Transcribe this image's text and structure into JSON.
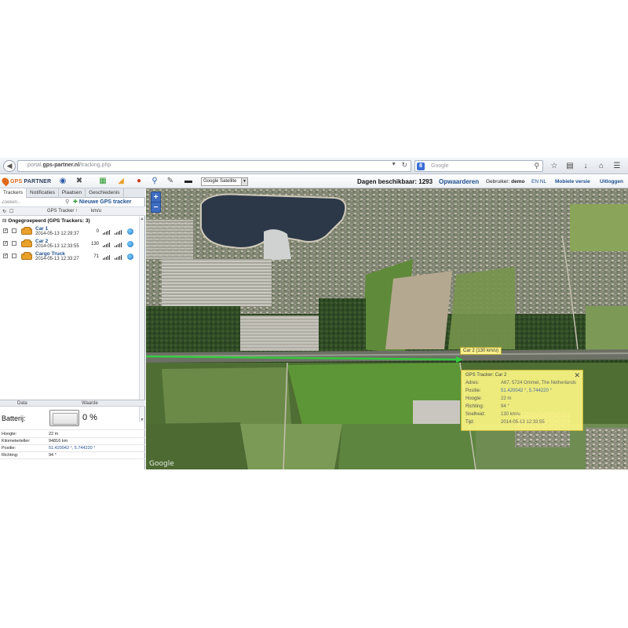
{
  "browser": {
    "url_prefix": "portal.",
    "url_domain": "gps-partner.nl",
    "url_path": "/tracking.php",
    "search_placeholder": "Google",
    "search_engine_letter": "8"
  },
  "app": {
    "logo_main": "GPS",
    "logo_sub": "PARTNER",
    "map_layer": "Google Satellite",
    "days_available": "Dagen beschikbaar: 1293",
    "upgrade": "Opwaarderen",
    "user_label": "Gebruiker:",
    "user_name": "demo",
    "language": "EN NL",
    "mobile": "Mobiele versie",
    "logout": "Uitloggen"
  },
  "tabs": [
    "Trackers",
    "Notificaties",
    "Plaatsen",
    "Geschiedenis"
  ],
  "tracker_search_placeholder": "Zoeken...",
  "new_tracker": "Nieuwe GPS tracker",
  "columns": {
    "tracker": "GPS Tracker ↑",
    "speed": "km/u"
  },
  "group": "Ongegroepeerd (GPS Trackers: 3)",
  "trackers": [
    {
      "name": "Car 1",
      "time": "2014-05-13 12:29:37",
      "speed": "0"
    },
    {
      "name": "Car 2",
      "time": "2014-05-13 12:33:55",
      "speed": "130"
    },
    {
      "name": "Cargo Truck",
      "time": "2014-05-13 12:33:27",
      "speed": "71"
    }
  ],
  "data_table": {
    "col_data": "Data",
    "col_value": "Waarde",
    "battery_label": "Batterij:",
    "battery_value": "0 %",
    "battery_level": 0,
    "rows": [
      {
        "key": "Hoogte:",
        "value": "22 m"
      },
      {
        "key": "Kilometerteller:",
        "value": "94816 km"
      },
      {
        "key": "Positie:",
        "value": "51.420042 °, 5.744220 °"
      },
      {
        "key": "Richting:",
        "value": "94 °"
      }
    ]
  },
  "map": {
    "zoom_in": "+",
    "zoom_out": "−",
    "car_label": "Car 2 (130 km/u)",
    "google": "Google",
    "popup": {
      "title": "GPS Tracker: Car 2",
      "rows": [
        {
          "key": "Adres:",
          "value": "A67, 5724 Ommel, The Netherlands"
        },
        {
          "key": "Positie:",
          "value": "51.420042 °, 5.744220 °"
        },
        {
          "key": "Hoogte:",
          "value": "22 m"
        },
        {
          "key": "Richting:",
          "value": "94 °"
        },
        {
          "key": "Snelheid:",
          "value": "130 km/u"
        },
        {
          "key": "Tijd:",
          "value": "2014-05-13 12:33:55"
        }
      ]
    }
  },
  "icons": {
    "back": "back-arrow-icon",
    "reload": "reload-icon",
    "search": "search-icon",
    "bookmark": "star-icon",
    "clipboard": "clipboard-icon",
    "download": "download-icon",
    "home": "home-icon",
    "menu": "menu-icon"
  },
  "colors": {
    "accent": "#1f4f8f",
    "logo": "#e06a1b",
    "route": "#2fd13a",
    "popup": "#faf582"
  }
}
